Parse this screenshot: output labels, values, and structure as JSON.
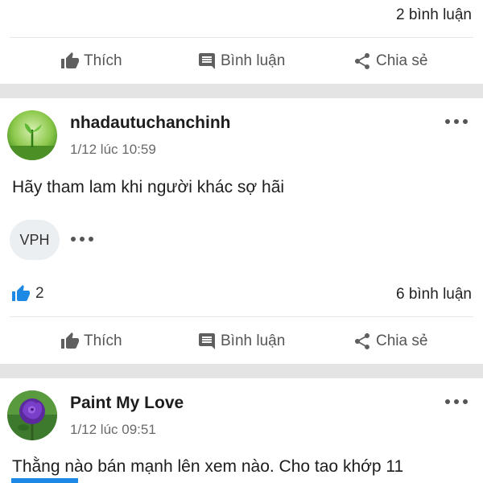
{
  "post1": {
    "comments": "2 bình luận"
  },
  "actions": {
    "like": "Thích",
    "comment": "Bình luận",
    "share": "Chia sẻ"
  },
  "post2": {
    "author": "nhadautuchanchinh",
    "time": "1/12 lúc 10:59",
    "content": "Hãy tham lam khi người khác sợ hãi",
    "reactor": "VPH",
    "likes": "2",
    "comments": "6 bình luận"
  },
  "post3": {
    "author": "Paint My Love",
    "time": "1/12 lúc 09:51",
    "content": "Thằng nào bán mạnh lên xem nào. Cho tao khớp 11"
  },
  "icons": {
    "like": "thumbs-up-icon",
    "comment": "speech-bubble-icon",
    "share": "share-icon",
    "more": "more-horizontal-icon"
  },
  "colors": {
    "accent": "#1e88e5",
    "separator": "#e4e4e4"
  }
}
